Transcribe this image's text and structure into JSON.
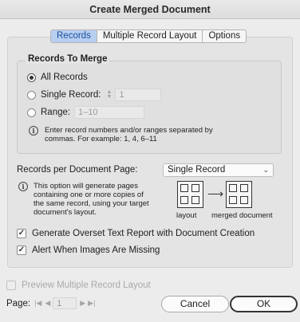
{
  "window": {
    "title": "Create Merged Document"
  },
  "tabs": [
    {
      "label": "Records",
      "active": true
    },
    {
      "label": "Multiple Record Layout",
      "active": false
    },
    {
      "label": "Options",
      "active": false
    }
  ],
  "records_to_merge": {
    "title": "Records To Merge",
    "all_records": {
      "label": "All Records",
      "selected": true
    },
    "single_record": {
      "label": "Single Record:",
      "value": "1",
      "selected": false
    },
    "range": {
      "label": "Range:",
      "placeholder": "1–10",
      "selected": false
    },
    "info_line1": "Enter record numbers and/or ranges separated by",
    "info_line2": "commas. For example: 1, 4, 6–11"
  },
  "records_per_page": {
    "label": "Records per Document Page:",
    "selected": "Single Record",
    "info_line1": "This option will generate pages",
    "info_line2": "containing one or more copies of",
    "info_line3": "the same record, using your target",
    "info_line4": "document's layout.",
    "diagram_layout_label": "layout",
    "diagram_merged_label": "merged document"
  },
  "options": {
    "overset_report": {
      "label": "Generate Overset Text Report with Document Creation",
      "checked": true
    },
    "missing_images": {
      "label": "Alert When Images Are Missing",
      "checked": true
    }
  },
  "preview": {
    "label": "Preview Multiple Record Layout",
    "checked": false
  },
  "page_nav": {
    "label": "Page:",
    "value": "1"
  },
  "buttons": {
    "cancel": "Cancel",
    "ok": "OK"
  },
  "colors": {
    "active_tab_bg": "#b8cff0",
    "active_tab_text": "#1a4f9c"
  }
}
